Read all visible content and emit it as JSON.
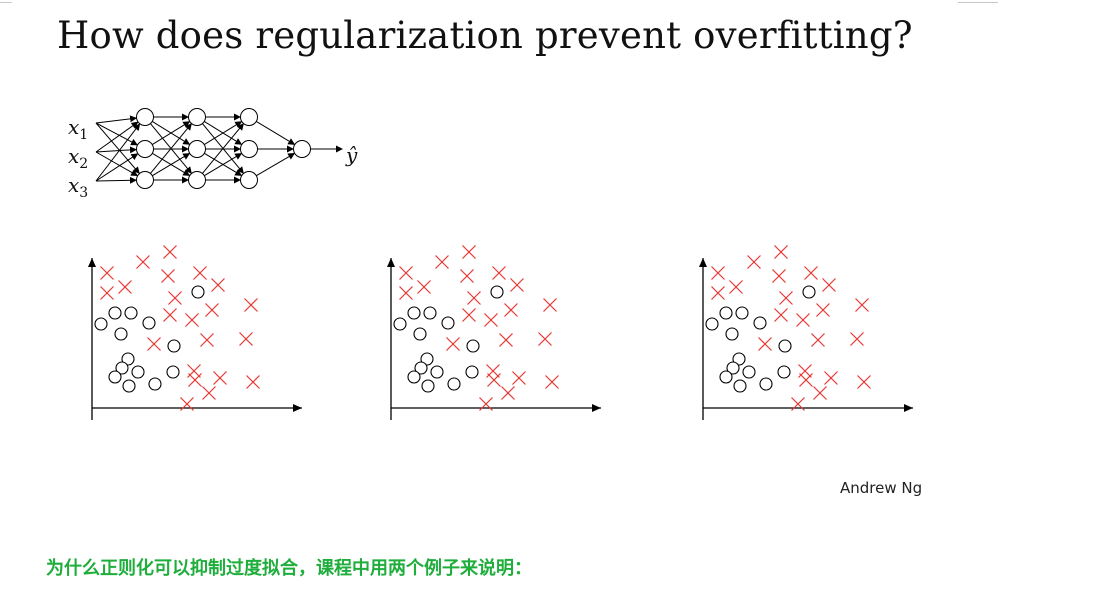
{
  "slide": {
    "title": "How does regularization prevent overfitting?",
    "author": "Andrew Ng",
    "caption": "为什么正则化可以抑制过度拟合，课程中用两个例子来说明："
  },
  "network": {
    "inputs": [
      "x",
      "x",
      "x"
    ],
    "input_subscripts": [
      "1",
      "2",
      "3"
    ],
    "hidden_layers": 3,
    "units_per_layer": 3,
    "output_label": "ŷ",
    "node_icon": "circle-node",
    "edge_icon": "arrow-edge"
  },
  "scatter_plots": [
    {
      "name": "plot-1",
      "markers": [
        "cross",
        "circle"
      ],
      "cross_color": "#e53935",
      "circle_color": "#000000"
    },
    {
      "name": "plot-2",
      "markers": [
        "cross",
        "circle"
      ],
      "cross_color": "#e53935",
      "circle_color": "#000000"
    },
    {
      "name": "plot-3",
      "markers": [
        "cross",
        "circle"
      ],
      "cross_color": "#e53935",
      "circle_color": "#000000"
    }
  ],
  "colors": {
    "title": "#111111",
    "caption": "#1fae3c",
    "cross": "#e53935",
    "axis": "#000000"
  }
}
